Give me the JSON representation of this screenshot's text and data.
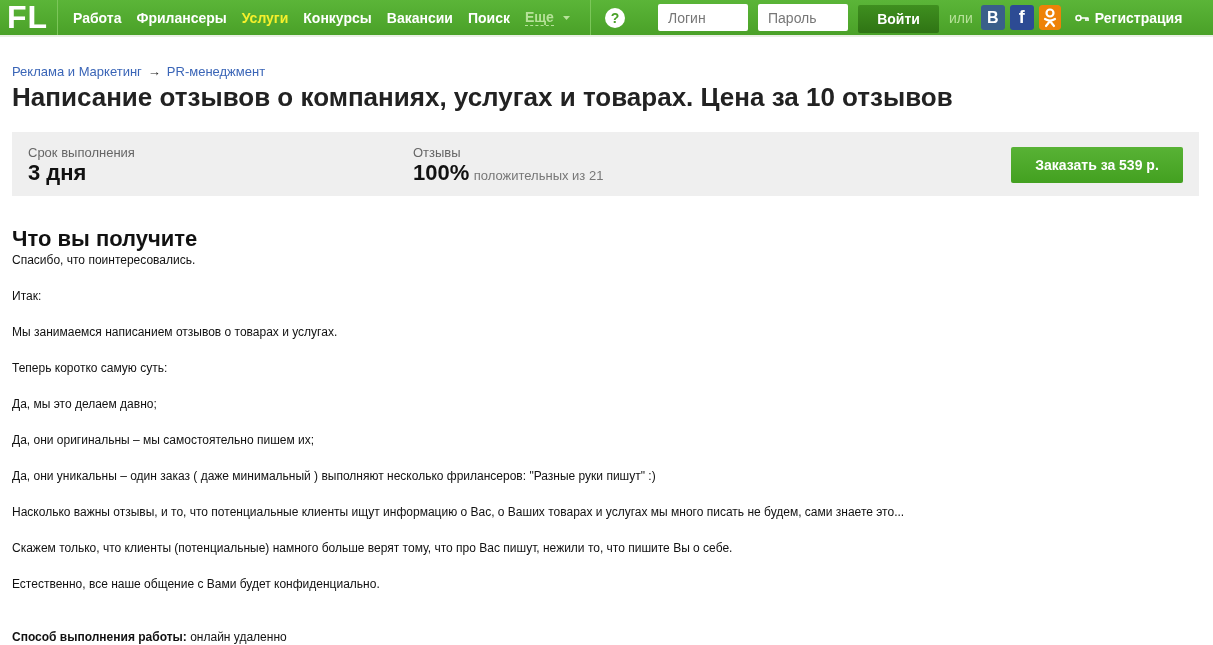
{
  "header": {
    "logo": "FL",
    "nav": [
      {
        "label": "Работа",
        "selected": false
      },
      {
        "label": "Фрилансеры",
        "selected": false
      },
      {
        "label": "Услуги",
        "selected": true
      },
      {
        "label": "Конкурсы",
        "selected": false
      },
      {
        "label": "Вакансии",
        "selected": false
      },
      {
        "label": "Поиск",
        "selected": false
      }
    ],
    "more": "Еще",
    "help": "?",
    "login": {
      "placeholder": "Логин"
    },
    "password": {
      "placeholder": "Пароль"
    },
    "login_button": "Войти",
    "or": "или",
    "social": [
      {
        "kind": "vk",
        "label": "B"
      },
      {
        "kind": "fb",
        "label": "f"
      },
      {
        "kind": "ok"
      }
    ],
    "register": "Регистрация"
  },
  "breadcrumbs": [
    "Реклама и Маркетинг",
    "PR-менеджмент"
  ],
  "breadcrumb_separator": "→",
  "title": "Написание отзывов о компаниях, услугах и товарах. Цена за 10 отзывов",
  "stats": {
    "term_label": "Срок выполнения",
    "term_value": "3 дня",
    "reviews_label": "Отзывы",
    "reviews_value": "100%",
    "reviews_note": "положительных из 21",
    "order_button": "Заказать за 539 р."
  },
  "section_title": "Что вы получите",
  "paragraphs": [
    "Спасибо, что поинтересовались.",
    "Итак:",
    "Мы занимаемся написанием отзывов о товарах и услугах.",
    "Теперь коротко самую суть:",
    "Да, мы это делаем давно;",
    "Да, они оригинальны – мы самостоятельно пишем их;",
    "Да, они уникальны – один заказ ( даже минимальный ) выполняют несколько фрилансеров: \"Разные руки пишут\" :)",
    "Насколько важны отзывы, и то, что потенциальные клиенты ищут информацию о Вас, о Ваших товарах и услугах мы много писать не будем, сами знаете это...",
    "Скажем только, что клиенты (потенциальные) намного больше верят тому, что про Вас пишут, нежили то, что пишите Вы о себе.",
    "Естественно, все наше общение с Вами будет конфиденциально."
  ],
  "method": "**Способ выполнения работы:** онлайн удаленно"
}
